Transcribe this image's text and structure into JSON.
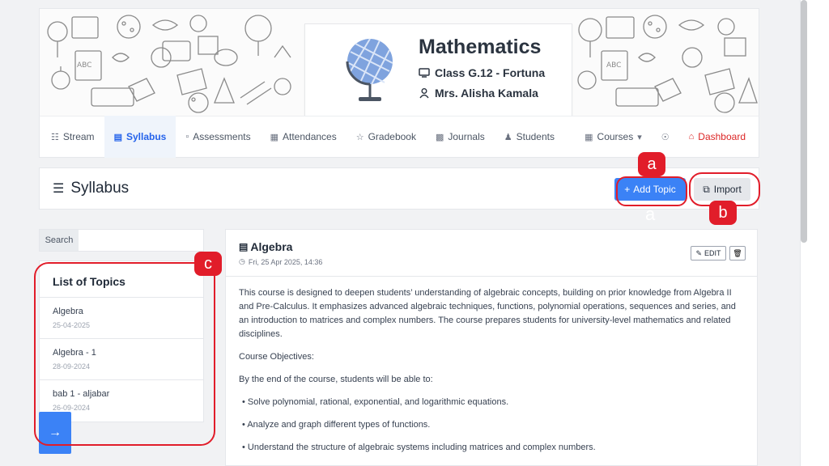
{
  "course": {
    "title": "Mathematics",
    "class": "Class G.12 - Fortuna",
    "teacher": "Mrs. Alisha Kamala"
  },
  "nav": {
    "items": [
      {
        "label": "Stream",
        "icon": "stream-icon"
      },
      {
        "label": "Syllabus",
        "icon": "book-icon"
      },
      {
        "label": "Assessments",
        "icon": "document-icon"
      },
      {
        "label": "Attendances",
        "icon": "calendar-icon"
      },
      {
        "label": "Gradebook",
        "icon": "star-icon"
      },
      {
        "label": "Journals",
        "icon": "journal-icon"
      },
      {
        "label": "Students",
        "icon": "users-icon"
      }
    ],
    "courses": "Courses",
    "dashboard": "Dashboard"
  },
  "syllabus": {
    "title": "Syllabus",
    "add_topic": "Add Topic",
    "import": "Import"
  },
  "search": {
    "label": "Search",
    "value": ""
  },
  "topics": {
    "title": "List of Topics",
    "items": [
      {
        "name": "Algebra",
        "date": "25-04-2025"
      },
      {
        "name": "Algebra - 1",
        "date": "28-09-2024"
      },
      {
        "name": "bab 1 - aljabar",
        "date": "26-09-2024"
      }
    ]
  },
  "content": {
    "title": "Algebra",
    "datetime": "Fri, 25 Apr 2025, 14:36",
    "edit": "EDIT",
    "intro": "This course is designed to deepen students’ understanding of algebraic concepts, building on prior knowledge from Algebra II and Pre-Calculus. It emphasizes advanced algebraic techniques, functions, polynomial operations, sequences and series, and an introduction to matrices and complex numbers. The course prepares students for university-level mathematics and related disciplines.",
    "objectives_heading": "Course Objectives:",
    "objectives_lead": "By the end of the course, students will be able to:",
    "objectives": [
      "Solve polynomial, rational, exponential, and logarithmic equations.",
      "Analyze and graph different types of functions.",
      "Understand the structure of algebraic systems including matrices and complex numbers."
    ]
  },
  "annotations": {
    "a": "a",
    "b": "b",
    "c": "c",
    "ghost_a": "a",
    "color": "#e11d2a"
  },
  "colors": {
    "primary": "#3b82f6",
    "danger": "#dc2626",
    "background": "#f1f2f4"
  }
}
